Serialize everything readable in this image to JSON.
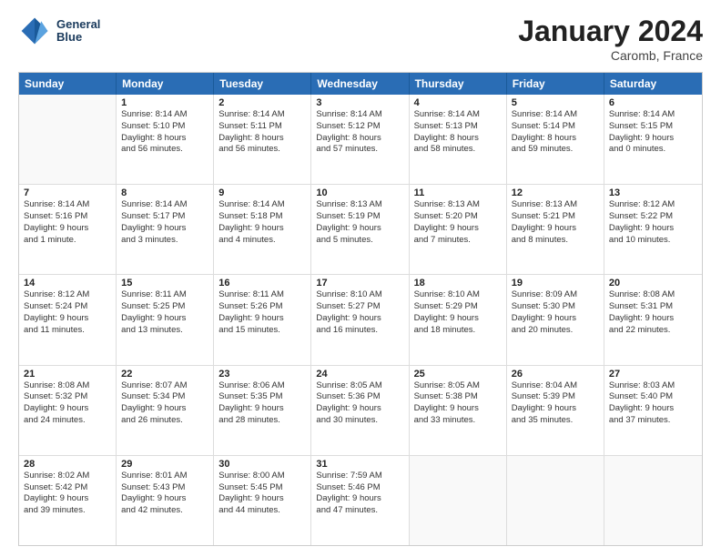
{
  "header": {
    "logo_line1": "General",
    "logo_line2": "Blue",
    "month": "January 2024",
    "location": "Caromb, France"
  },
  "weekdays": [
    "Sunday",
    "Monday",
    "Tuesday",
    "Wednesday",
    "Thursday",
    "Friday",
    "Saturday"
  ],
  "rows": [
    [
      {
        "day": "",
        "lines": []
      },
      {
        "day": "1",
        "lines": [
          "Sunrise: 8:14 AM",
          "Sunset: 5:10 PM",
          "Daylight: 8 hours",
          "and 56 minutes."
        ]
      },
      {
        "day": "2",
        "lines": [
          "Sunrise: 8:14 AM",
          "Sunset: 5:11 PM",
          "Daylight: 8 hours",
          "and 56 minutes."
        ]
      },
      {
        "day": "3",
        "lines": [
          "Sunrise: 8:14 AM",
          "Sunset: 5:12 PM",
          "Daylight: 8 hours",
          "and 57 minutes."
        ]
      },
      {
        "day": "4",
        "lines": [
          "Sunrise: 8:14 AM",
          "Sunset: 5:13 PM",
          "Daylight: 8 hours",
          "and 58 minutes."
        ]
      },
      {
        "day": "5",
        "lines": [
          "Sunrise: 8:14 AM",
          "Sunset: 5:14 PM",
          "Daylight: 8 hours",
          "and 59 minutes."
        ]
      },
      {
        "day": "6",
        "lines": [
          "Sunrise: 8:14 AM",
          "Sunset: 5:15 PM",
          "Daylight: 9 hours",
          "and 0 minutes."
        ]
      }
    ],
    [
      {
        "day": "7",
        "lines": [
          "Sunrise: 8:14 AM",
          "Sunset: 5:16 PM",
          "Daylight: 9 hours",
          "and 1 minute."
        ]
      },
      {
        "day": "8",
        "lines": [
          "Sunrise: 8:14 AM",
          "Sunset: 5:17 PM",
          "Daylight: 9 hours",
          "and 3 minutes."
        ]
      },
      {
        "day": "9",
        "lines": [
          "Sunrise: 8:14 AM",
          "Sunset: 5:18 PM",
          "Daylight: 9 hours",
          "and 4 minutes."
        ]
      },
      {
        "day": "10",
        "lines": [
          "Sunrise: 8:13 AM",
          "Sunset: 5:19 PM",
          "Daylight: 9 hours",
          "and 5 minutes."
        ]
      },
      {
        "day": "11",
        "lines": [
          "Sunrise: 8:13 AM",
          "Sunset: 5:20 PM",
          "Daylight: 9 hours",
          "and 7 minutes."
        ]
      },
      {
        "day": "12",
        "lines": [
          "Sunrise: 8:13 AM",
          "Sunset: 5:21 PM",
          "Daylight: 9 hours",
          "and 8 minutes."
        ]
      },
      {
        "day": "13",
        "lines": [
          "Sunrise: 8:12 AM",
          "Sunset: 5:22 PM",
          "Daylight: 9 hours",
          "and 10 minutes."
        ]
      }
    ],
    [
      {
        "day": "14",
        "lines": [
          "Sunrise: 8:12 AM",
          "Sunset: 5:24 PM",
          "Daylight: 9 hours",
          "and 11 minutes."
        ]
      },
      {
        "day": "15",
        "lines": [
          "Sunrise: 8:11 AM",
          "Sunset: 5:25 PM",
          "Daylight: 9 hours",
          "and 13 minutes."
        ]
      },
      {
        "day": "16",
        "lines": [
          "Sunrise: 8:11 AM",
          "Sunset: 5:26 PM",
          "Daylight: 9 hours",
          "and 15 minutes."
        ]
      },
      {
        "day": "17",
        "lines": [
          "Sunrise: 8:10 AM",
          "Sunset: 5:27 PM",
          "Daylight: 9 hours",
          "and 16 minutes."
        ]
      },
      {
        "day": "18",
        "lines": [
          "Sunrise: 8:10 AM",
          "Sunset: 5:29 PM",
          "Daylight: 9 hours",
          "and 18 minutes."
        ]
      },
      {
        "day": "19",
        "lines": [
          "Sunrise: 8:09 AM",
          "Sunset: 5:30 PM",
          "Daylight: 9 hours",
          "and 20 minutes."
        ]
      },
      {
        "day": "20",
        "lines": [
          "Sunrise: 8:08 AM",
          "Sunset: 5:31 PM",
          "Daylight: 9 hours",
          "and 22 minutes."
        ]
      }
    ],
    [
      {
        "day": "21",
        "lines": [
          "Sunrise: 8:08 AM",
          "Sunset: 5:32 PM",
          "Daylight: 9 hours",
          "and 24 minutes."
        ]
      },
      {
        "day": "22",
        "lines": [
          "Sunrise: 8:07 AM",
          "Sunset: 5:34 PM",
          "Daylight: 9 hours",
          "and 26 minutes."
        ]
      },
      {
        "day": "23",
        "lines": [
          "Sunrise: 8:06 AM",
          "Sunset: 5:35 PM",
          "Daylight: 9 hours",
          "and 28 minutes."
        ]
      },
      {
        "day": "24",
        "lines": [
          "Sunrise: 8:05 AM",
          "Sunset: 5:36 PM",
          "Daylight: 9 hours",
          "and 30 minutes."
        ]
      },
      {
        "day": "25",
        "lines": [
          "Sunrise: 8:05 AM",
          "Sunset: 5:38 PM",
          "Daylight: 9 hours",
          "and 33 minutes."
        ]
      },
      {
        "day": "26",
        "lines": [
          "Sunrise: 8:04 AM",
          "Sunset: 5:39 PM",
          "Daylight: 9 hours",
          "and 35 minutes."
        ]
      },
      {
        "day": "27",
        "lines": [
          "Sunrise: 8:03 AM",
          "Sunset: 5:40 PM",
          "Daylight: 9 hours",
          "and 37 minutes."
        ]
      }
    ],
    [
      {
        "day": "28",
        "lines": [
          "Sunrise: 8:02 AM",
          "Sunset: 5:42 PM",
          "Daylight: 9 hours",
          "and 39 minutes."
        ]
      },
      {
        "day": "29",
        "lines": [
          "Sunrise: 8:01 AM",
          "Sunset: 5:43 PM",
          "Daylight: 9 hours",
          "and 42 minutes."
        ]
      },
      {
        "day": "30",
        "lines": [
          "Sunrise: 8:00 AM",
          "Sunset: 5:45 PM",
          "Daylight: 9 hours",
          "and 44 minutes."
        ]
      },
      {
        "day": "31",
        "lines": [
          "Sunrise: 7:59 AM",
          "Sunset: 5:46 PM",
          "Daylight: 9 hours",
          "and 47 minutes."
        ]
      },
      {
        "day": "",
        "lines": []
      },
      {
        "day": "",
        "lines": []
      },
      {
        "day": "",
        "lines": []
      }
    ]
  ]
}
